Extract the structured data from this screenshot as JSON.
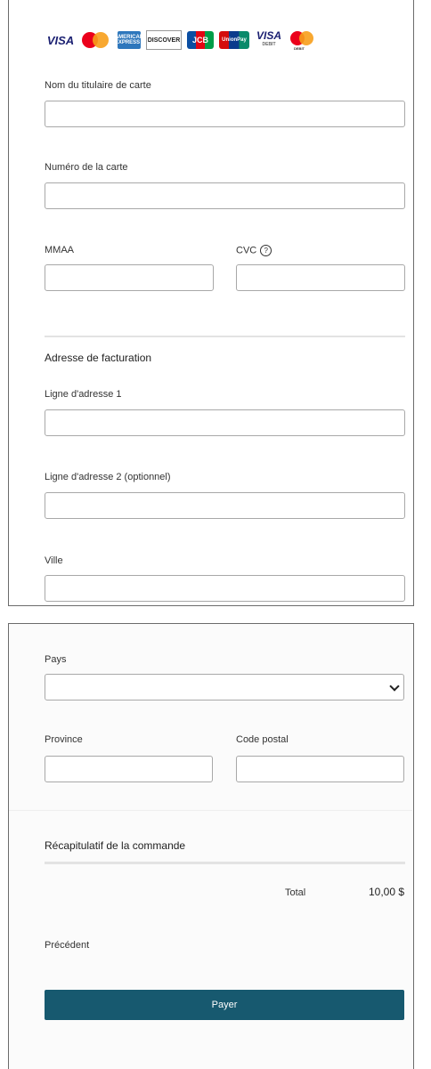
{
  "card_logos": [
    "visa-logo",
    "mastercard-logo",
    "amex-logo",
    "discover-logo",
    "jcb-logo",
    "unionpay-logo",
    "visa-debit-logo",
    "mastercard-debit-logo"
  ],
  "logo_text": {
    "visa": "VISA",
    "amex": "AMERICAN EXPRESS",
    "discover": "DISCOVER",
    "jcb": "JCB",
    "unionpay": "UnionPay",
    "visa_debit": "VISA",
    "visa_debit_sub": "DEBIT",
    "mc_debit_sub": "DEBIT"
  },
  "form": {
    "cardholder_label": "Nom du titulaire de carte",
    "card_number_label": "Numéro de la carte",
    "expiry_label": "MMAA",
    "cvc_label": "CVC",
    "cvc_help": "?",
    "billing_title": "Adresse de facturation",
    "address1_label": "Ligne d'adresse 1",
    "address2_label": "Ligne d'adresse 2 (optionnel)",
    "city_label": "Ville",
    "country_label": "Pays",
    "province_label": "Province",
    "postal_label": "Code postal"
  },
  "summary": {
    "title": "Récapitulatif de la commande",
    "total_label": "Total",
    "total_value": "10,00 $"
  },
  "actions": {
    "back_label": "Précédent",
    "pay_label": "Payer"
  },
  "colors": {
    "pay_button": "#17596f"
  }
}
